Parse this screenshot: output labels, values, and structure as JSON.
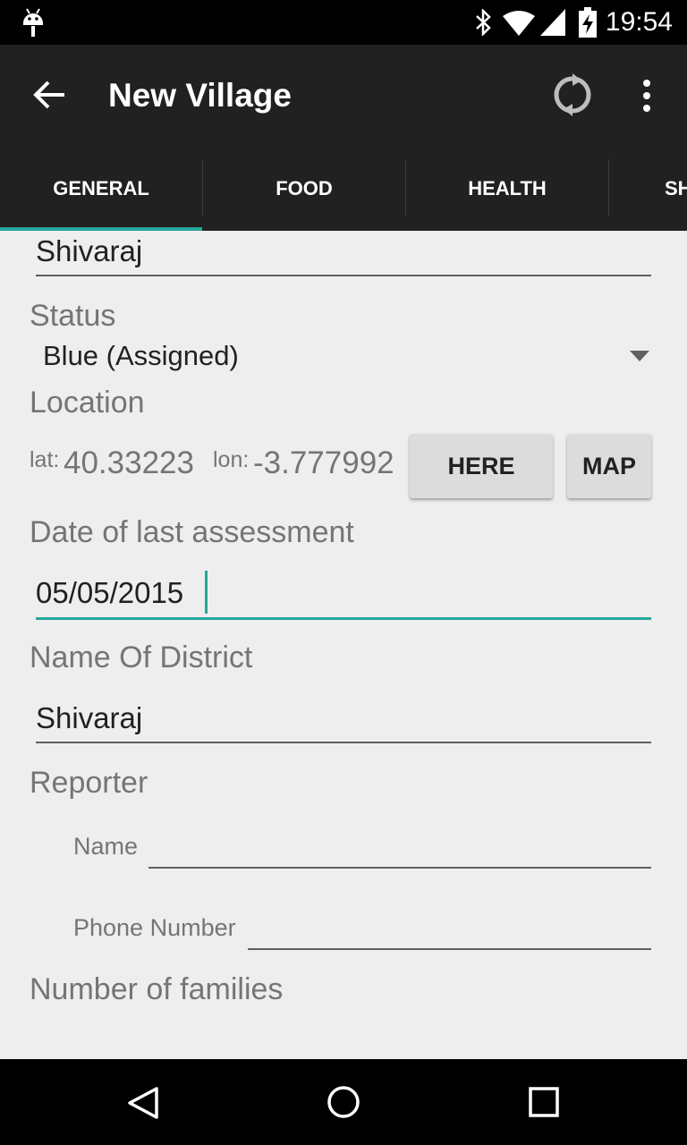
{
  "status_bar": {
    "time": "19:54",
    "icons": [
      "android-debug-icon",
      "bluetooth-icon",
      "wifi-icon",
      "cell-signal-icon",
      "battery-charging-icon"
    ]
  },
  "app_bar": {
    "title": "New Village",
    "back_icon": "arrow-left-icon",
    "sync_icon": "sync-icon",
    "overflow_icon": "more-vert-icon"
  },
  "tabs": [
    {
      "label": "GENERAL",
      "selected": true
    },
    {
      "label": "FOOD",
      "selected": false
    },
    {
      "label": "HEALTH",
      "selected": false
    },
    {
      "label": "SH",
      "selected": false
    }
  ],
  "form": {
    "village_name_value": "Shivaraj",
    "status_label": "Status",
    "status_value": "Blue (Assigned)",
    "location_label": "Location",
    "lat_prefix": "lat:",
    "lat_value": "40.33223",
    "lon_prefix": "lon:",
    "lon_value": "-3.777992",
    "here_button": "HERE",
    "map_button": "MAP",
    "date_label": "Date of last assessment",
    "date_value": "05/05/2015",
    "district_label": "Name Of District",
    "district_value": "Shivaraj",
    "reporter_label": "Reporter",
    "reporter_name_label": "Name",
    "reporter_name_value": "",
    "reporter_phone_label": "Phone Number",
    "reporter_phone_value": "",
    "families_label": "Number of families"
  },
  "colors": {
    "accent": "#26a69a",
    "app_bar": "#212121",
    "background": "#eeeeee"
  }
}
